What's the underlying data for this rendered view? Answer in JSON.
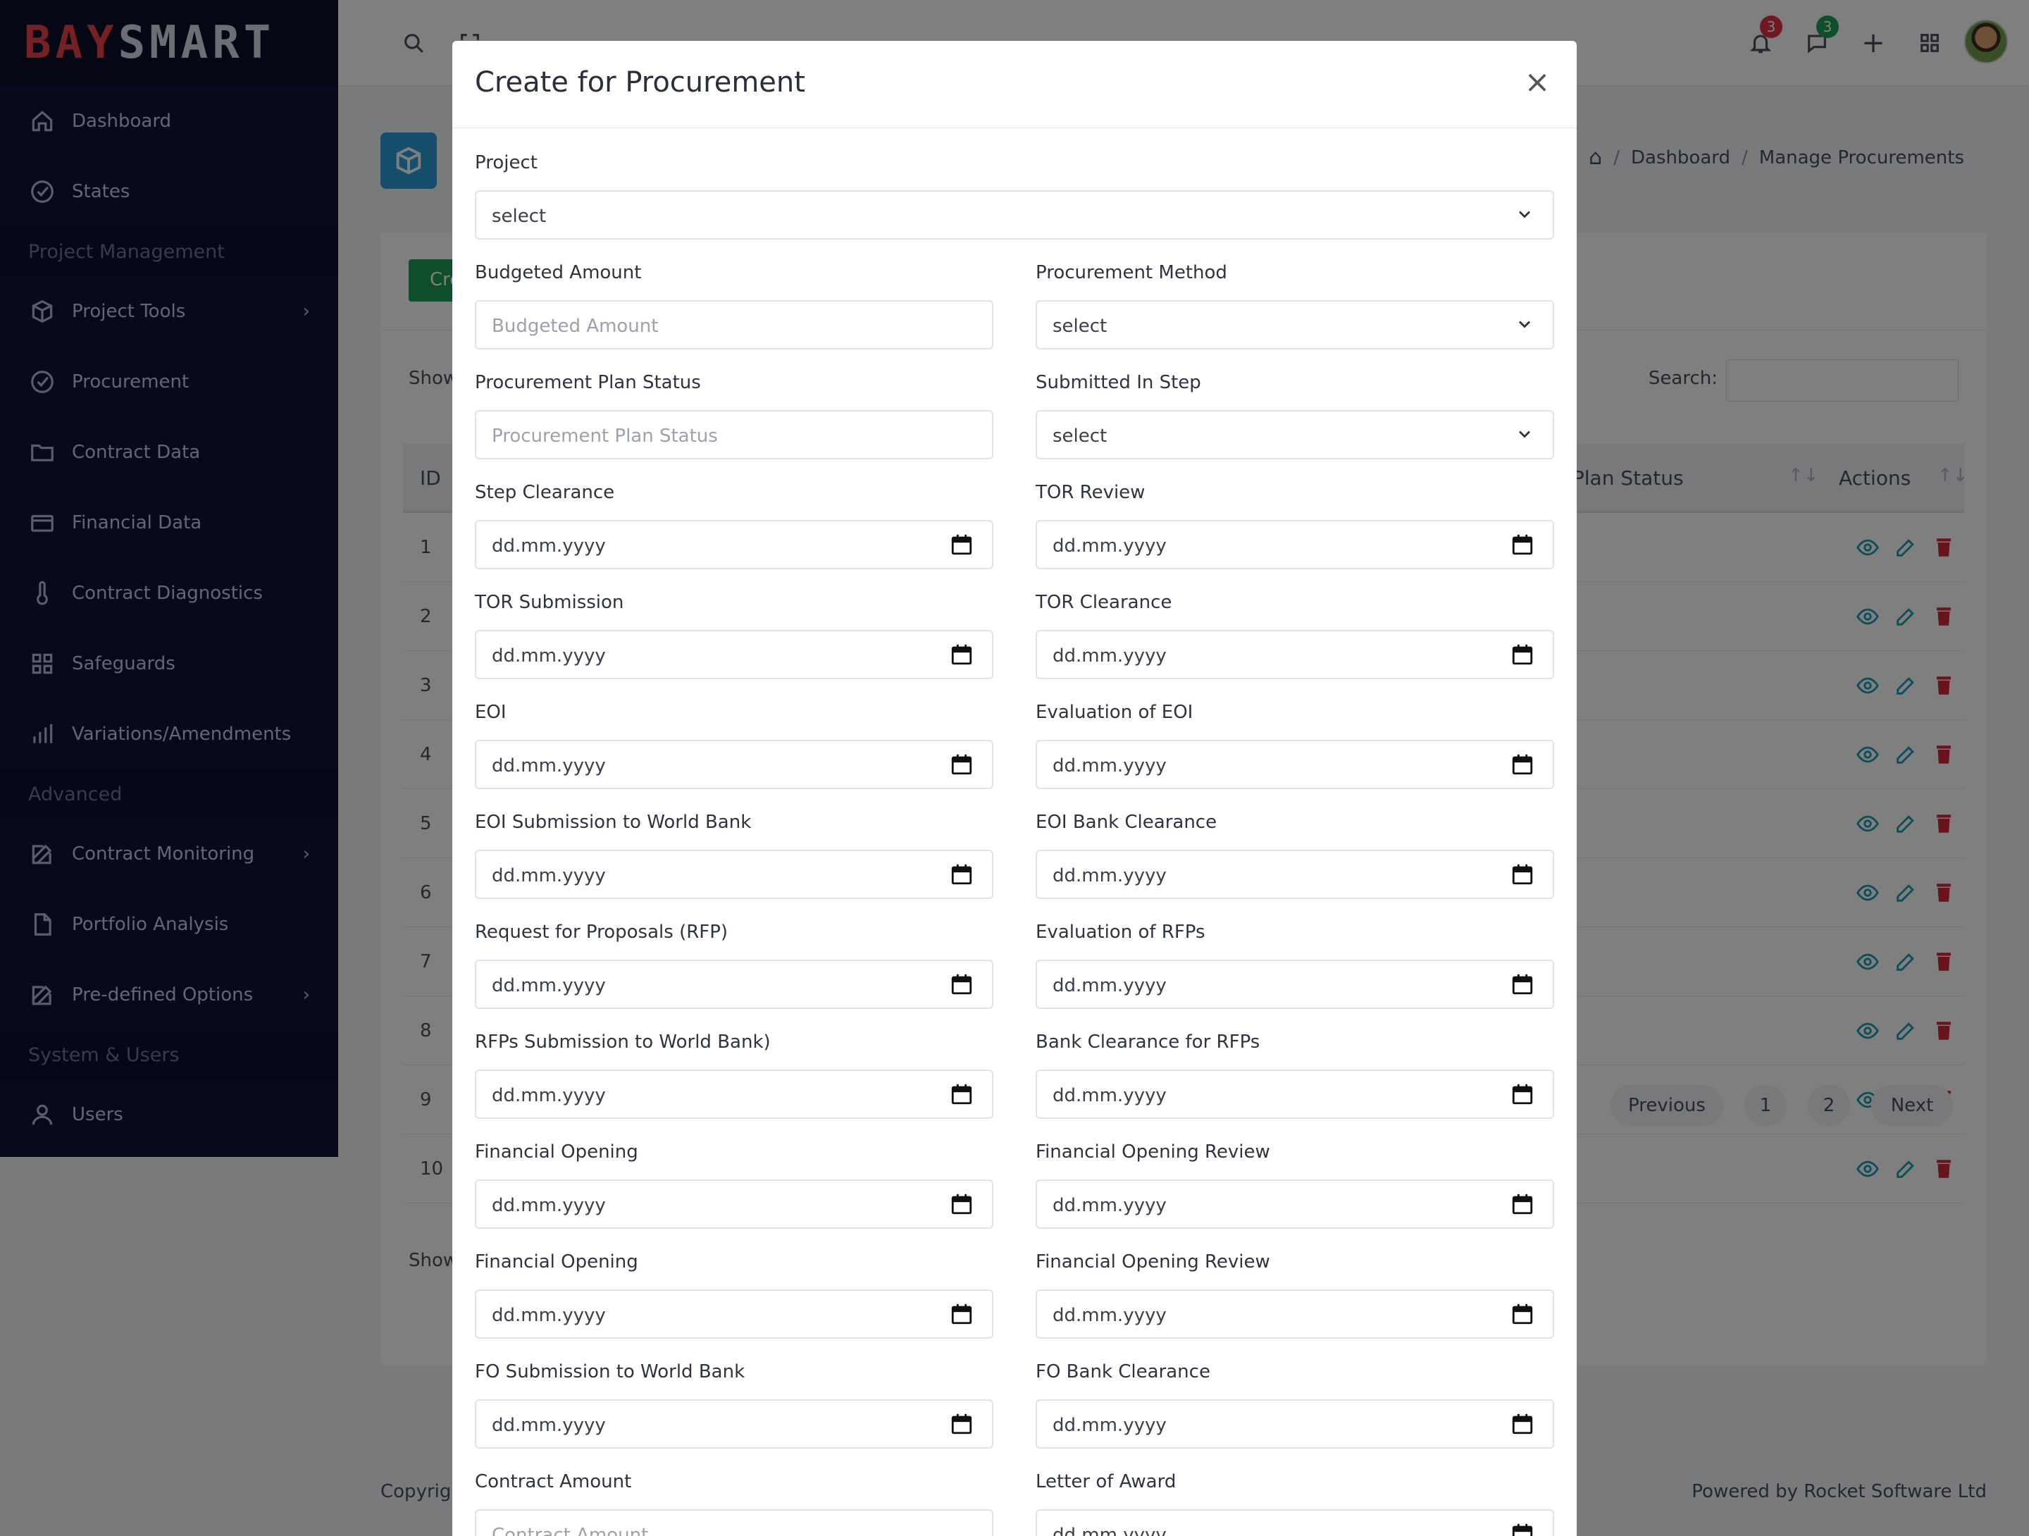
{
  "brand": {
    "part1": "BAY",
    "part2": "SMART"
  },
  "sidebar": {
    "items_top": [
      {
        "label": "Dashboard",
        "icon": "home-icon"
      },
      {
        "label": "States",
        "icon": "check-circle-icon"
      }
    ],
    "section1": "Project Management",
    "items_pm": [
      {
        "label": "Project Tools",
        "icon": "box-icon",
        "chevron": "›"
      },
      {
        "label": "Procurement",
        "icon": "check-circle-icon"
      },
      {
        "label": "Contract Data",
        "icon": "folder-icon"
      },
      {
        "label": "Financial Data",
        "icon": "credit-card-icon"
      },
      {
        "label": "Contract Diagnostics",
        "icon": "thermometer-icon"
      },
      {
        "label": "Safeguards",
        "icon": "grid-icon"
      },
      {
        "label": "Variations/Amendments",
        "icon": "bar-chart-icon"
      }
    ],
    "section2": "Advanced",
    "items_adv": [
      {
        "label": "Contract Monitoring",
        "icon": "edit-icon",
        "chevron": "›"
      },
      {
        "label": "Portfolio Analysis",
        "icon": "file-icon"
      },
      {
        "label": "Pre-defined Options",
        "icon": "edit-icon",
        "chevron": "›"
      }
    ],
    "section3": "System & Users",
    "items_sys": [
      {
        "label": "Users",
        "icon": "user-icon"
      }
    ]
  },
  "topbar": {
    "notifications_count": "3",
    "messages_count": "3",
    "plus": "+"
  },
  "breadcrumb": {
    "home": "⌂",
    "sep": "/",
    "dashboard": "Dashboard",
    "current": "Manage Procurements"
  },
  "card": {
    "create_btn": "Create",
    "show_top": "Show",
    "search_label": "Search:",
    "col_id": "ID",
    "col_plan_status": "t Plan Status",
    "col_actions": "Actions",
    "sort_glyph": "↑↓",
    "rows": [
      "1",
      "2",
      "3",
      "4",
      "5",
      "6",
      "7",
      "8",
      "9",
      "10"
    ],
    "show_bottom": "Show",
    "pagination": {
      "previous": "Previous",
      "page1": "1",
      "page2": "2",
      "next": "Next"
    }
  },
  "footer": {
    "left": "Copyright",
    "right": "Powered by Rocket Software Ltd"
  },
  "modal": {
    "title": "Create for Procurement",
    "close": "×",
    "project_label": "Project",
    "project_value": "select",
    "date_placeholder": "dd.mm.yyyy",
    "rows": [
      {
        "left": {
          "label": "Budgeted Amount",
          "type": "text",
          "placeholder": "Budgeted Amount"
        },
        "right": {
          "label": "Procurement Method",
          "type": "select",
          "value": "select"
        }
      },
      {
        "left": {
          "label": "Procurement Plan Status",
          "type": "text",
          "placeholder": "Procurement Plan Status"
        },
        "right": {
          "label": "Submitted In Step",
          "type": "select",
          "value": "select"
        }
      },
      {
        "left": {
          "label": "Step Clearance",
          "type": "date"
        },
        "right": {
          "label": "TOR Review",
          "type": "date"
        }
      },
      {
        "left": {
          "label": "TOR Submission",
          "type": "date"
        },
        "right": {
          "label": "TOR Clearance",
          "type": "date"
        }
      },
      {
        "left": {
          "label": "EOI",
          "type": "date"
        },
        "right": {
          "label": "Evaluation of EOI",
          "type": "date"
        }
      },
      {
        "left": {
          "label": "EOI Submission to World Bank",
          "type": "date"
        },
        "right": {
          "label": "EOI Bank Clearance",
          "type": "date"
        }
      },
      {
        "left": {
          "label": "Request for Proposals (RFP)",
          "type": "date"
        },
        "right": {
          "label": "Evaluation of RFPs",
          "type": "date"
        }
      },
      {
        "left": {
          "label": "RFPs Submission to World Bank)",
          "type": "date"
        },
        "right": {
          "label": "Bank Clearance for RFPs",
          "type": "date"
        }
      },
      {
        "left": {
          "label": "Financial Opening",
          "type": "date"
        },
        "right": {
          "label": "Financial Opening Review",
          "type": "date"
        }
      },
      {
        "left": {
          "label": "Financial Opening",
          "type": "date"
        },
        "right": {
          "label": "Financial Opening Review",
          "type": "date"
        }
      },
      {
        "left": {
          "label": "FO Submission to World Bank",
          "type": "date"
        },
        "right": {
          "label": "FO Bank Clearance",
          "type": "date"
        }
      },
      {
        "left": {
          "label": "Contract Amount",
          "type": "text",
          "placeholder": "Contract Amount"
        },
        "right": {
          "label": "Letter of Award",
          "type": "date"
        }
      }
    ]
  },
  "colors": {
    "sidebar_bg": "#0e1538",
    "brand_red": "#e8424a",
    "accent_blue": "#2c9ed8",
    "create_green": "#1f9d55",
    "action_view": "#1a9bb0",
    "action_delete": "#d2263a",
    "badge_red": "#e03142",
    "badge_green": "#1f9d55"
  }
}
